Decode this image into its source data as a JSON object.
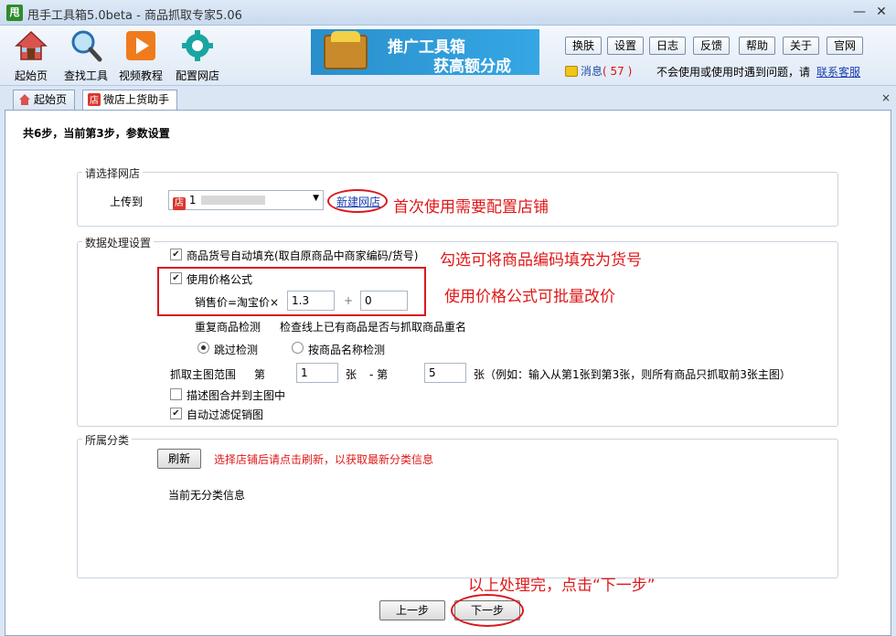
{
  "window": {
    "logo": "甩",
    "title": "甩手工具箱5.0beta - 商品抓取专家5.06",
    "minimize": "—",
    "close": "✕"
  },
  "toolbar": {
    "tools": [
      "起始页",
      "查找工具",
      "视频教程",
      "配置网店"
    ],
    "banner": {
      "line1": "推广工具箱",
      "line2": "获高额分成"
    },
    "buttons": [
      "换肤",
      "设置",
      "日志",
      "反馈",
      "帮助",
      "关于",
      "官网"
    ],
    "message_label": "消息",
    "message_count": "( 57 )",
    "help_text": "不会使用或使用时遇到问题，请",
    "contact_link": "联系客服"
  },
  "tabs": [
    {
      "label": "起始页",
      "icon": "home-icon"
    },
    {
      "label": "微店上货助手",
      "icon": "shop-icon"
    }
  ],
  "tab_close": "×",
  "page": {
    "step_title": "共6步，当前第3步，参数设置",
    "store_group": {
      "label": "请选择网店",
      "upload_to": "上传到",
      "store_icon": "店",
      "store_value": "1",
      "new_store_link": "新建网店"
    },
    "data_group": {
      "label": "数据处理设置",
      "auto_fill_label": "商品货号自动填充(取自原商品中商家编码/货号)",
      "auto_fill_checked": true,
      "price_formula_label": "使用价格公式",
      "price_formula_checked": true,
      "price_formula_text": "销售价=淘宝价×",
      "multiplier": "1.3",
      "plus": "+",
      "addend": "0",
      "dup_check_label": "重复商品检测",
      "dup_check_desc": "检查线上已有商品是否与抓取商品重名",
      "skip_check": "跳过检测",
      "by_name_check": "按商品名称检测",
      "skip_selected": true,
      "range_label": "抓取主图范围",
      "range_from_prefix": "第",
      "range_from": "1",
      "range_mid": "张",
      "range_to_prefix": "- 第",
      "range_to": "5",
      "range_suffix": "张（例如：输入从第1张到第3张，则所有商品只抓取前3张主图）",
      "merge_desc_label": "描述图合并到主图中",
      "merge_desc_checked": false,
      "auto_filter_label": "自动过滤促销图",
      "auto_filter_checked": true
    },
    "category_group": {
      "label": "所属分类",
      "refresh_button": "刷新",
      "refresh_tip": "选择店铺后请点击刷新，以获取最新分类信息",
      "empty_text": "当前无分类信息"
    },
    "prev_button": "上一步",
    "next_button": "下一步"
  },
  "annotations": {
    "store": "首次使用需要配置店铺",
    "auto_fill": "勾选可将商品编码填充为货号",
    "price": "使用价格公式可批量改价",
    "next": "以上处理完，点击“下一步”"
  },
  "colors": {
    "annotation": "#e01818",
    "link": "#1a3fb0",
    "banner": "#2a8fcc",
    "window_bg": "#dbe6f4"
  }
}
